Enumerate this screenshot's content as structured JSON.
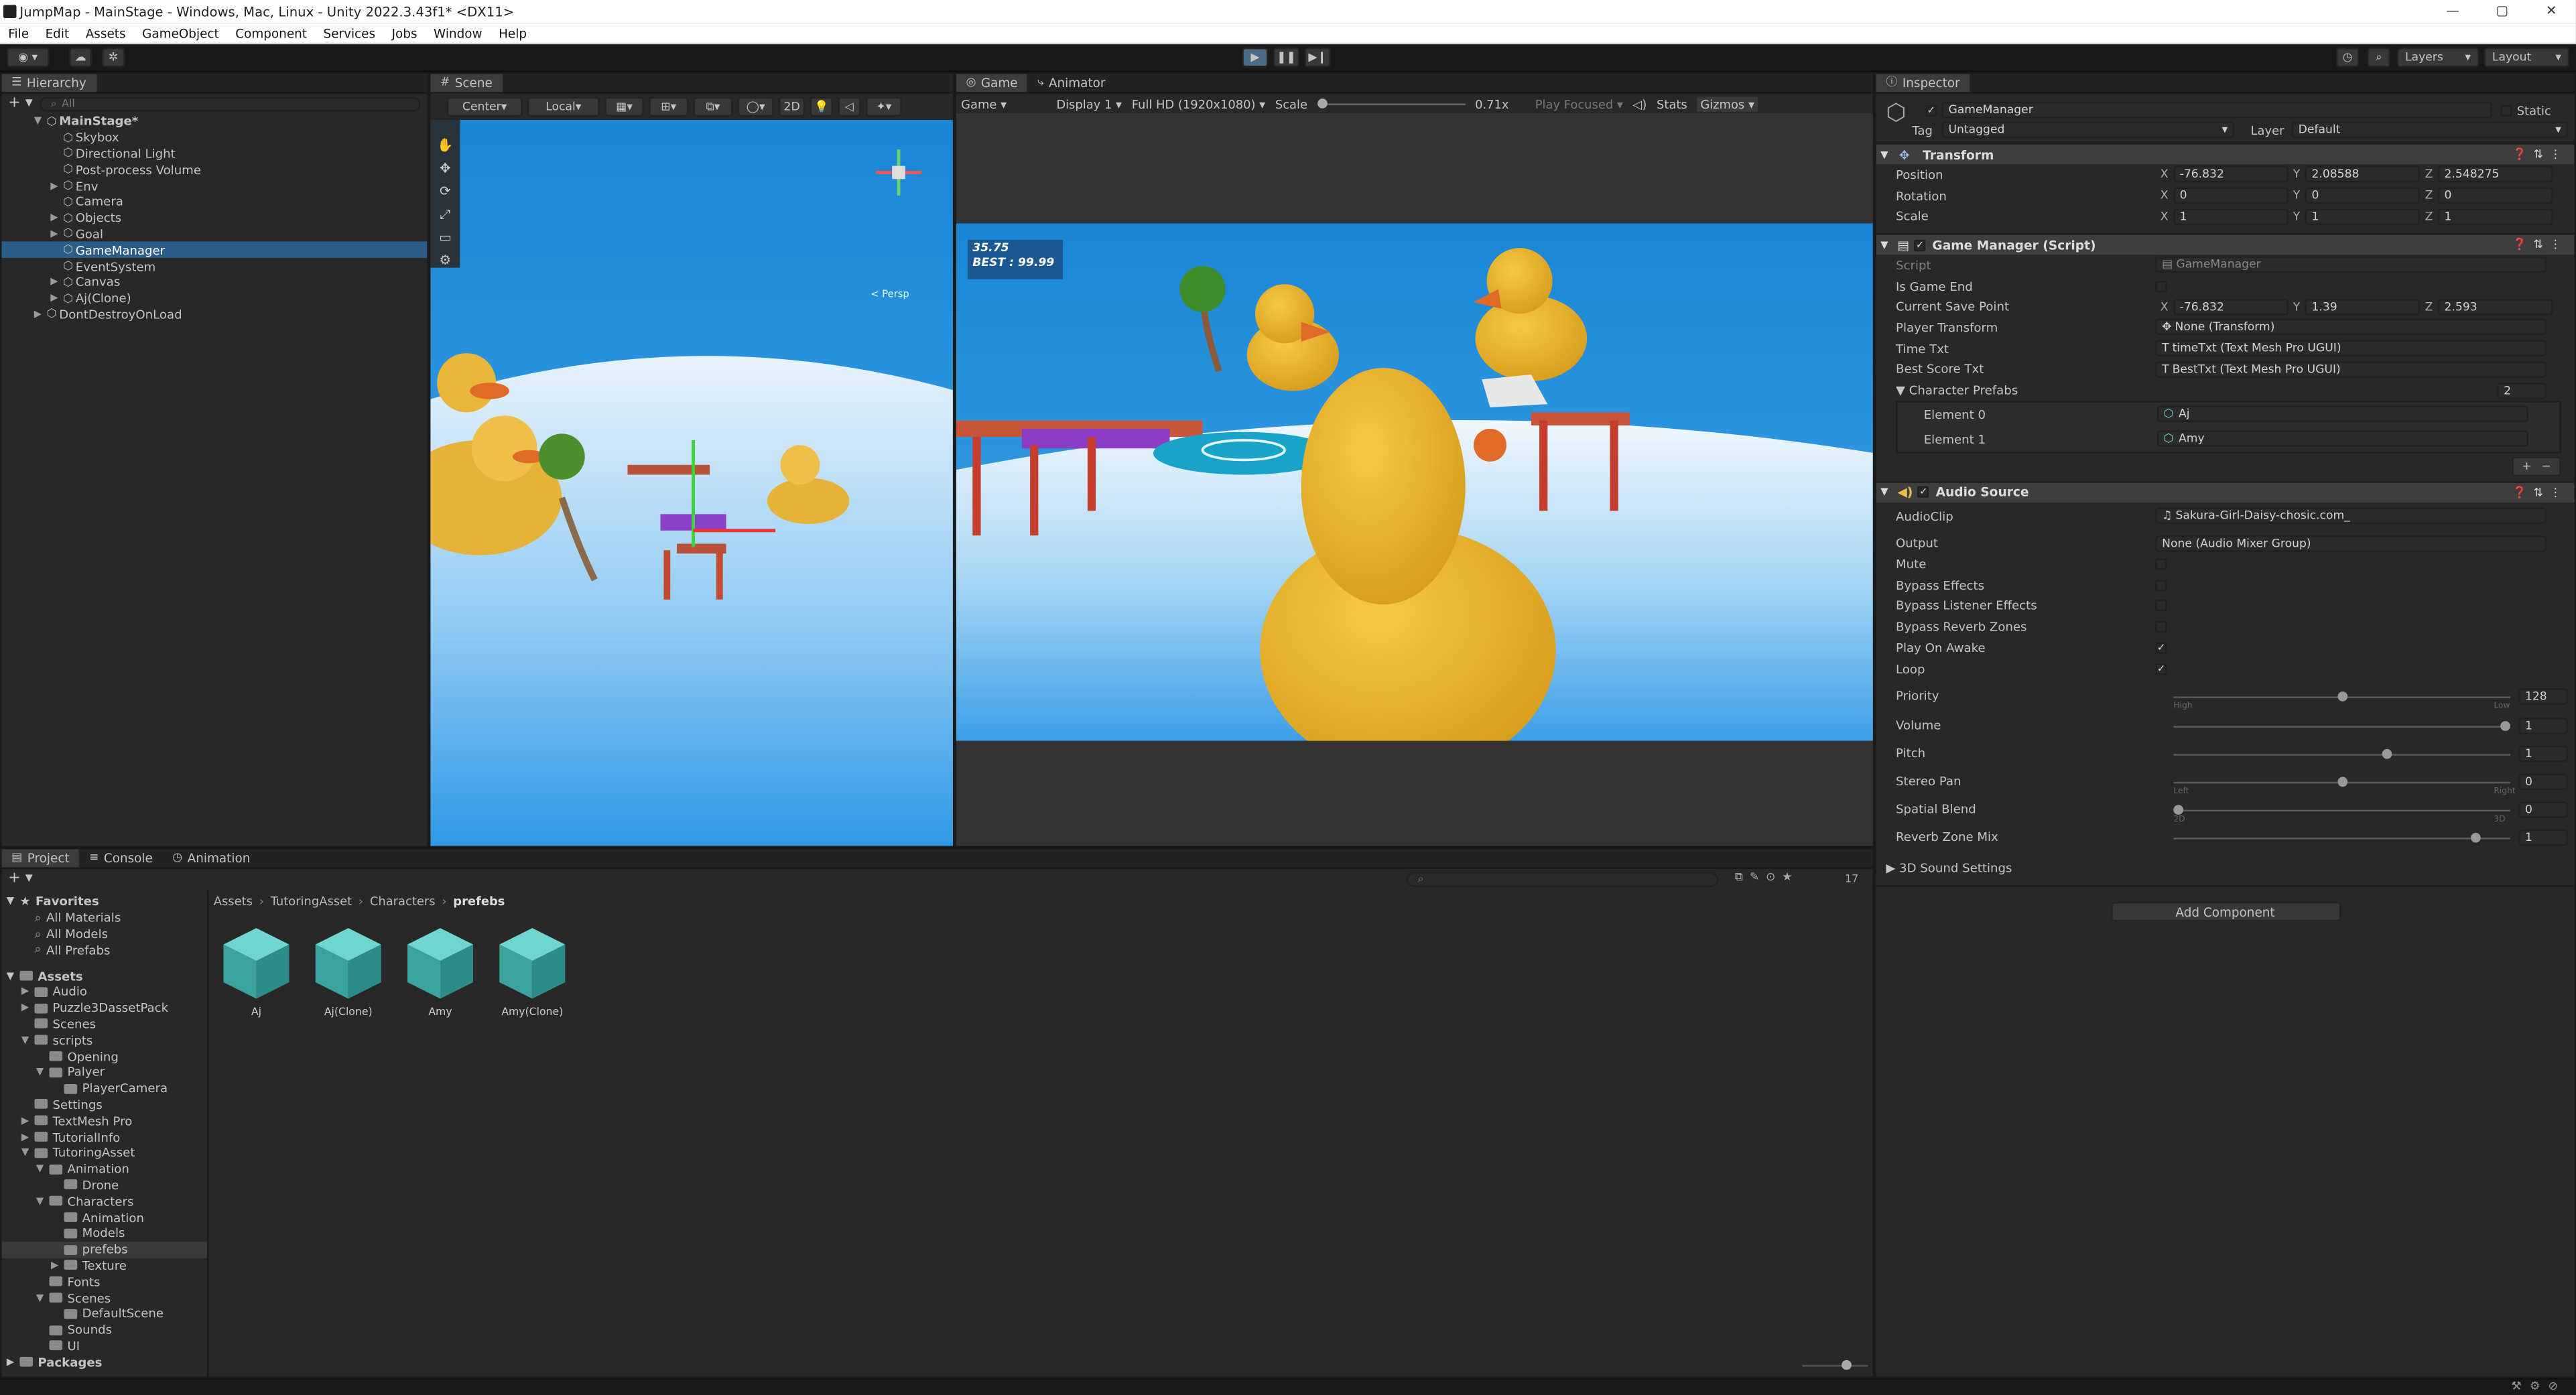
{
  "window": {
    "title": "JumpMap - MainStage - Windows, Mac, Linux - Unity 2022.3.43f1* <DX11>",
    "minimize": "—",
    "maximize": "▢",
    "close": "✕"
  },
  "menu": [
    "File",
    "Edit",
    "Assets",
    "GameObject",
    "Component",
    "Services",
    "Jobs",
    "Window",
    "Help"
  ],
  "toolbar": {
    "layers": "Layers",
    "layout": "Layout"
  },
  "hierarchy": {
    "tab": "Hierarchy",
    "search_placeholder": "All",
    "scene": "MainStage*",
    "items": [
      {
        "label": "Skybox",
        "level": 1,
        "arrow": false
      },
      {
        "label": "Directional Light",
        "level": 1,
        "arrow": false
      },
      {
        "label": "Post-process Volume",
        "level": 1,
        "arrow": false
      },
      {
        "label": "Env",
        "level": 1,
        "arrow": true
      },
      {
        "label": "Camera",
        "level": 1,
        "arrow": false
      },
      {
        "label": "Objects",
        "level": 1,
        "arrow": true
      },
      {
        "label": "Goal",
        "level": 1,
        "arrow": true
      },
      {
        "label": "GameManager",
        "level": 1,
        "arrow": false,
        "selected": true
      },
      {
        "label": "EventSystem",
        "level": 1,
        "arrow": false
      },
      {
        "label": "Canvas",
        "level": 1,
        "arrow": true
      },
      {
        "label": "Aj(Clone)",
        "level": 1,
        "arrow": true
      }
    ],
    "dont_destroy": "DontDestroyOnLoad"
  },
  "scene": {
    "tab": "Scene",
    "center": "Center",
    "local": "Local",
    "mode2d": "2D",
    "persp": "< Persp"
  },
  "game": {
    "tab": "Game",
    "tab2": "Animator",
    "display_mode": "Game",
    "display": "Display 1",
    "resolution": "Full HD (1920x1080)",
    "scale_label": "Scale",
    "scale_value": "0.71x",
    "play_focused": "Play Focused",
    "stats": "Stats",
    "gizmos": "Gizmos",
    "hud_time": "35.75",
    "hud_best": "BEST : 99.99"
  },
  "project": {
    "tabs": [
      "Project",
      "Console",
      "Animation"
    ],
    "count": "17",
    "breadcrumb": [
      "Assets",
      "TutoringAsset",
      "Characters",
      "prefebs"
    ],
    "favorites": {
      "label": "Favorites",
      "items": [
        "All Materials",
        "All Models",
        "All Prefabs"
      ]
    },
    "assets_label": "Assets",
    "tree": [
      {
        "label": "Audio",
        "level": 1,
        "arrow": true
      },
      {
        "label": "Puzzle3DassetPack",
        "level": 1,
        "arrow": true
      },
      {
        "label": "Scenes",
        "level": 1,
        "arrow": false
      },
      {
        "label": "scripts",
        "level": 1,
        "arrow": true,
        "open": true
      },
      {
        "label": "Opening",
        "level": 2,
        "arrow": false
      },
      {
        "label": "Palyer",
        "level": 2,
        "arrow": true,
        "open": true
      },
      {
        "label": "PlayerCamera",
        "level": 3,
        "arrow": false
      },
      {
        "label": "Settings",
        "level": 1,
        "arrow": false
      },
      {
        "label": "TextMesh Pro",
        "level": 1,
        "arrow": true
      },
      {
        "label": "TutorialInfo",
        "level": 1,
        "arrow": true
      },
      {
        "label": "TutoringAsset",
        "level": 1,
        "arrow": true,
        "open": true
      },
      {
        "label": "Animation",
        "level": 2,
        "arrow": true,
        "open": true
      },
      {
        "label": "Drone",
        "level": 3,
        "arrow": false
      },
      {
        "label": "Characters",
        "level": 2,
        "arrow": true,
        "open": true
      },
      {
        "label": "Animation",
        "level": 3,
        "arrow": false
      },
      {
        "label": "Models",
        "level": 3,
        "arrow": false
      },
      {
        "label": "prefebs",
        "level": 3,
        "arrow": false,
        "selected": true
      },
      {
        "label": "Texture",
        "level": 3,
        "arrow": true
      },
      {
        "label": "Fonts",
        "level": 2,
        "arrow": false
      },
      {
        "label": "Scenes",
        "level": 2,
        "arrow": true,
        "open": true
      },
      {
        "label": "DefaultScene",
        "level": 3,
        "arrow": false
      },
      {
        "label": "Sounds",
        "level": 2,
        "arrow": false
      },
      {
        "label": "UI",
        "level": 2,
        "arrow": false
      }
    ],
    "packages_label": "Packages",
    "assets": [
      "Aj",
      "Aj(Clone)",
      "Amy",
      "Amy(Clone)"
    ]
  },
  "inspector": {
    "tab": "Inspector",
    "object_name": "GameManager",
    "static": "Static",
    "tag_label": "Tag",
    "tag": "Untagged",
    "layer_label": "Layer",
    "layer": "Default",
    "transform": {
      "title": "Transform",
      "rows": [
        {
          "label": "Position",
          "x": "-76.832",
          "y": "2.08588",
          "z": "2.548275"
        },
        {
          "label": "Rotation",
          "x": "0",
          "y": "0",
          "z": "0"
        },
        {
          "label": "Scale",
          "x": "1",
          "y": "1",
          "z": "1"
        }
      ]
    },
    "game_manager": {
      "title": "Game Manager (Script)",
      "script_label": "Script",
      "script": "GameManager",
      "is_game_end": "Is Game End",
      "save_point_label": "Current Save Point",
      "save_point": {
        "x": "-76.832",
        "y": "1.39",
        "z": "2.593"
      },
      "player_transform_label": "Player Transform",
      "player_transform": "None (Transform)",
      "time_txt_label": "Time Txt",
      "time_txt": "timeTxt (Text Mesh Pro UGUI)",
      "best_txt_label": "Best Score Txt",
      "best_txt": "BestTxt (Text Mesh Pro UGUI)",
      "prefabs_label": "Character Prefabs",
      "prefabs_count": "2",
      "elements": [
        {
          "label": "Element 0",
          "value": "Aj"
        },
        {
          "label": "Element 1",
          "value": "Amy"
        }
      ],
      "plus": "+",
      "minus": "−"
    },
    "audio": {
      "title": "Audio Source",
      "clip_label": "AudioClip",
      "clip": "Sakura-Girl-Daisy-chosic.com_",
      "output_label": "Output",
      "output": "None (Audio Mixer Group)",
      "toggles": [
        {
          "label": "Mute",
          "checked": false
        },
        {
          "label": "Bypass Effects",
          "checked": false
        },
        {
          "label": "Bypass Listener Effects",
          "checked": false
        },
        {
          "label": "Bypass Reverb Zones",
          "checked": false
        },
        {
          "label": "Play On Awake",
          "checked": true
        },
        {
          "label": "Loop",
          "checked": true
        }
      ],
      "sliders": [
        {
          "label": "Priority",
          "value": "128",
          "pos": 0.5,
          "min_label": "High",
          "max_label": "Low"
        },
        {
          "label": "Volume",
          "value": "1",
          "pos": 1.0
        },
        {
          "label": "Pitch",
          "value": "1",
          "pos": 0.64
        },
        {
          "label": "Stereo Pan",
          "value": "0",
          "pos": 0.5,
          "min_label": "Left",
          "max_label": "Right"
        },
        {
          "label": "Spatial Blend",
          "value": "0",
          "pos": 0.0,
          "min_label": "2D",
          "max_label": "3D"
        },
        {
          "label": "Reverb Zone Mix",
          "value": "1",
          "pos": 0.91
        }
      ],
      "sound3d": "3D Sound Settings"
    },
    "add_component": "Add Component"
  }
}
